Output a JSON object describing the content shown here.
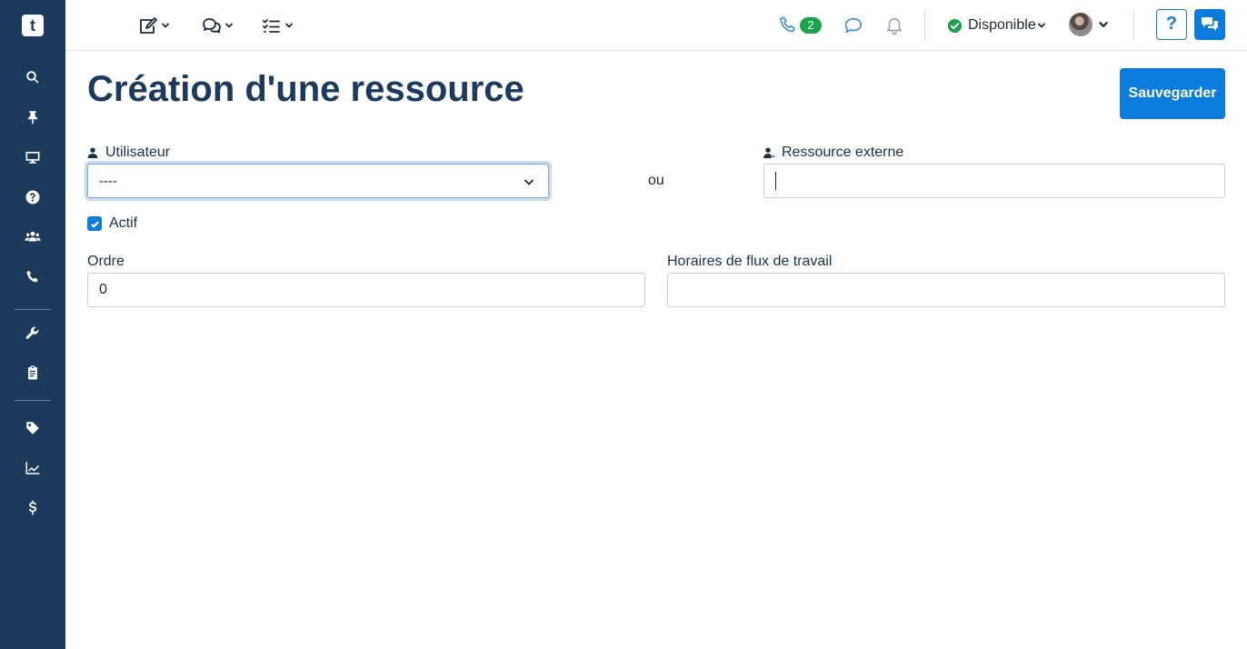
{
  "app": {
    "logo_text": "t"
  },
  "sidebar": {
    "items": [
      {
        "icon": "search-icon"
      },
      {
        "icon": "pin-icon"
      },
      {
        "icon": "monitor-icon"
      },
      {
        "icon": "help-circle-icon"
      },
      {
        "icon": "users-icon"
      },
      {
        "icon": "phone-icon"
      },
      {
        "icon": "wrench-icon"
      },
      {
        "icon": "clipboard-icon"
      },
      {
        "icon": "tag-icon"
      },
      {
        "icon": "chart-line-icon"
      },
      {
        "icon": "dollar-icon"
      }
    ]
  },
  "topbar": {
    "call_count": "2",
    "status_label": "Disponible",
    "help_label": "?",
    "status_color": "#1aa34a",
    "accent_color": "#0a7cdc"
  },
  "page": {
    "title": "Création d'une ressource",
    "save_label": "Sauvegarder"
  },
  "form": {
    "user_label": "Utilisateur",
    "user_value": "----",
    "or_label": "ou",
    "external_label": "Ressource externe",
    "external_value": "",
    "active_label": "Actif",
    "active_checked": true,
    "order_label": "Ordre",
    "order_value": "0",
    "schedule_label": "Horaires de flux de travail",
    "schedule_value": ""
  }
}
